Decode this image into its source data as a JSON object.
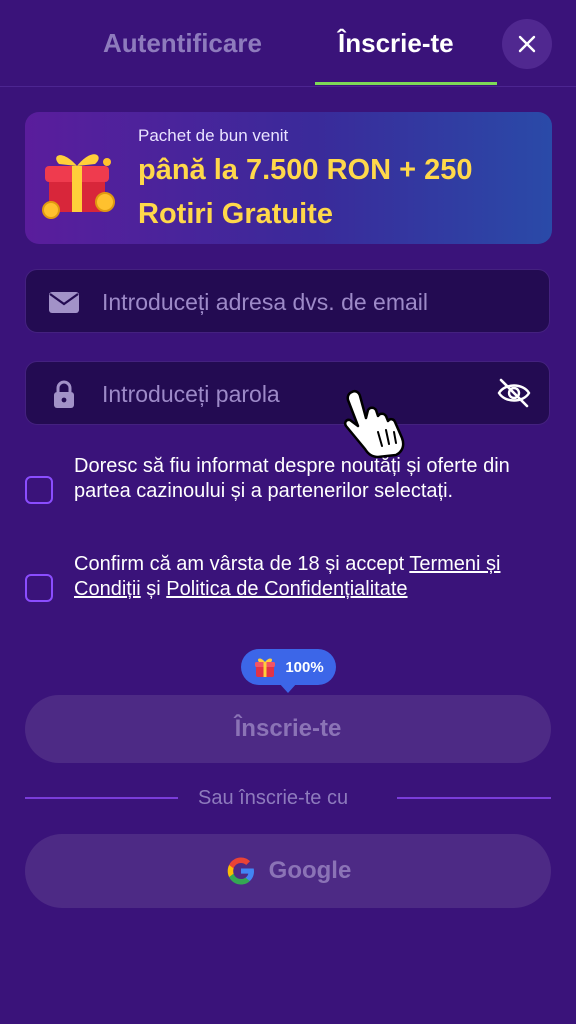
{
  "tabs": {
    "login": "Autentificare",
    "register": "Înscrie-te"
  },
  "promo": {
    "subtitle": "Pachet de bun venit",
    "title": "până la 7.500 RON + 250 Rotiri Gratuite"
  },
  "email": {
    "placeholder": "Introduceți adresa dvs. de email",
    "value": ""
  },
  "password": {
    "placeholder": "Introduceți parola",
    "value": ""
  },
  "consent": {
    "newsletter": "Doresc să fiu informat despre noutăți și oferte din partea cazinoului și a partenerilor selectați.",
    "age_prefix": "Confirm că am vârsta de 18 și accept ",
    "terms_link": "Termeni și Condiții",
    "and": " și ",
    "privacy_link": "Politica de Confidențialitate"
  },
  "badge": {
    "percent": "100%"
  },
  "submit": {
    "label": "Înscrie-te"
  },
  "alt": {
    "or_text": "Sau înscrie-te cu",
    "google_label": "Google"
  },
  "colors": {
    "background": "#3a137a",
    "accent_green": "#7ed957",
    "promo_title": "#ffd84a",
    "checkbox_border": "#8b4dff",
    "badge": "#3c66e8"
  }
}
